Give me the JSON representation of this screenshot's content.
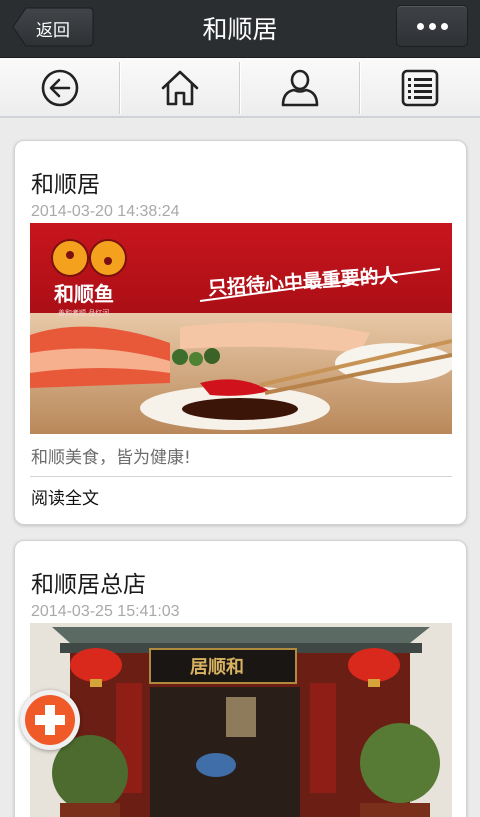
{
  "topbar": {
    "back_label": "返回",
    "title": "和顺居"
  },
  "toolbar": {
    "icons": [
      "back-circle-icon",
      "home-icon",
      "user-icon",
      "list-icon"
    ]
  },
  "articles": [
    {
      "title": "和顺居",
      "date": "2014-03-20 14:38:24",
      "image": {
        "brand": "和顺鱼",
        "brand_sub": "善和者顺 品红河",
        "slogan": "只招待心中最重要的人"
      },
      "summary": "和顺美食，皆为健康!",
      "read_more": "阅读全文"
    },
    {
      "title": "和顺居总店",
      "date": "2014-03-25 15:41:03",
      "image": {
        "sign": "居顺和"
      }
    }
  ],
  "fab_icon": "plus-icon"
}
